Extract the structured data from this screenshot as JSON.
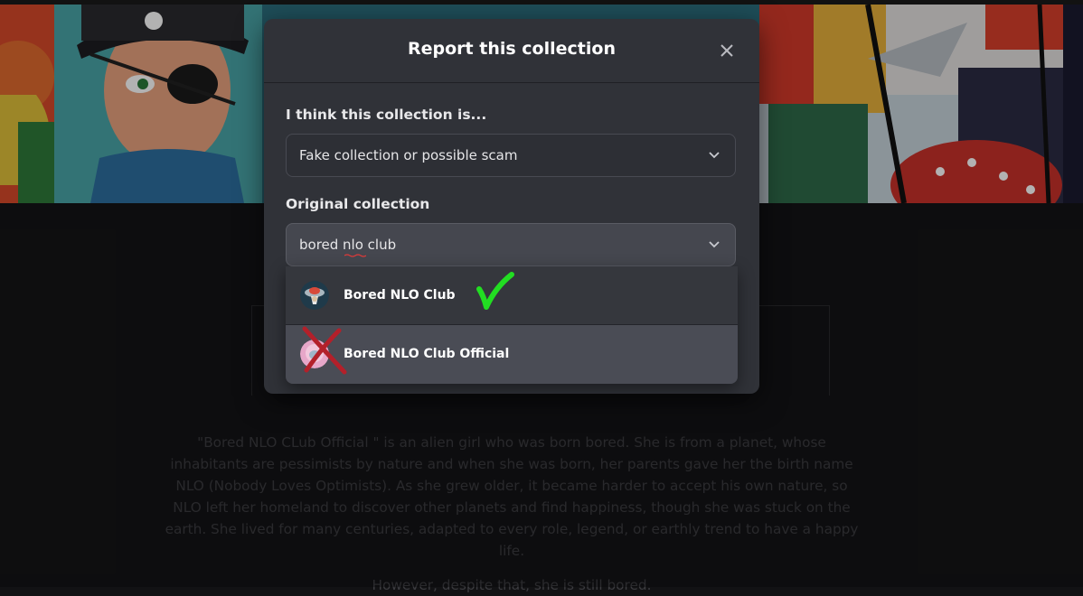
{
  "modal": {
    "title": "Report this collection",
    "reason_label": "I think this collection is...",
    "reason_value": "Fake collection or possible scam",
    "original_label": "Original collection",
    "search_value": "bored nlo club"
  },
  "dropdown": {
    "options": [
      {
        "name": "Bored NLO Club",
        "annotation": "check-mark"
      },
      {
        "name": "Bored NLO Club Official",
        "annotation": "cross-mark"
      }
    ]
  },
  "background": {
    "description": "\"Bored NLO CLub Official \" is an alien girl who was born bored. She is from a planet, whose inhabitants are pessimists by nature and when she was born, her parents gave her the birth name NLO (Nobody Loves Optimists). As she grew older, it became harder to accept his own nature, so NLO left her homeland to discover other planets and find happiness, though she was stuck on the earth. She lived for many centuries, adapted to every role, legend, or earthly trend to have a happy life.",
    "description_2": "However, despite that, she is still bored."
  },
  "colors": {
    "modal_bg": "#303238",
    "check": "#22dd22",
    "cross": "#b3202a"
  }
}
